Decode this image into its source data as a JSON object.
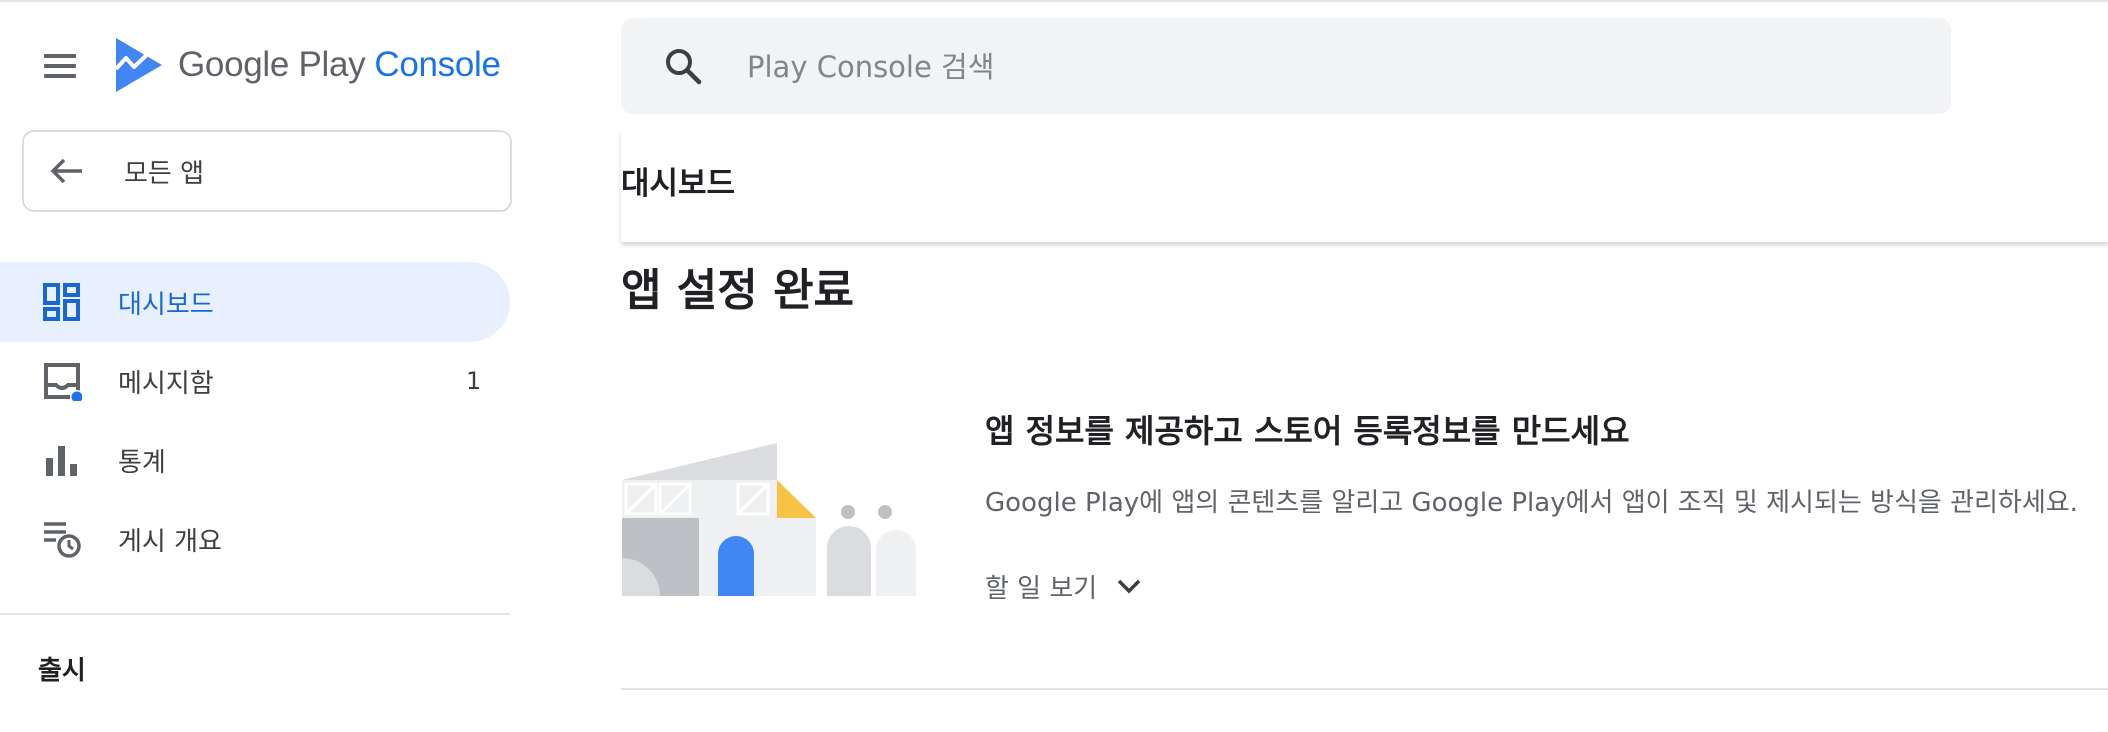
{
  "header": {
    "menu_icon": "hamburger-menu-icon",
    "logo_icon": "google-play-console-logo",
    "logo_google_play": "Google Play",
    "logo_console": "Console",
    "brand_color": "#1a73e8"
  },
  "sidebar": {
    "back_icon": "arrow-back-icon",
    "all_apps_label": "모든 앱",
    "items": [
      {
        "label": "대시보드",
        "icon": "dashboard-icon",
        "active": true
      },
      {
        "label": "메시지함",
        "icon": "inbox-icon",
        "count": "1",
        "has_notification_dot": true
      },
      {
        "label": "통계",
        "icon": "bar-chart-icon"
      },
      {
        "label": "게시 개요",
        "icon": "publishing-overview-icon"
      }
    ],
    "section_release": "출시"
  },
  "search": {
    "icon": "search-icon",
    "placeholder": "Play Console 검색"
  },
  "main": {
    "page_title": "대시보드",
    "section_title": "앱 설정 완료",
    "task": {
      "illustration": "building-illustration",
      "title": "앱 정보를 제공하고 스토어 등록정보를 만드세요",
      "description": "Google Play에 앱의 콘텐츠를 알리고 Google Play에서 앱이 조직 및 제시되는 방식을 관리하세요.",
      "toggle_label": "할 일 보기",
      "toggle_icon": "chevron-down-icon"
    }
  },
  "colors": {
    "active_bg": "#e8f0fe",
    "active_text": "#1967d2",
    "notification_dot": "#1a73e8"
  }
}
